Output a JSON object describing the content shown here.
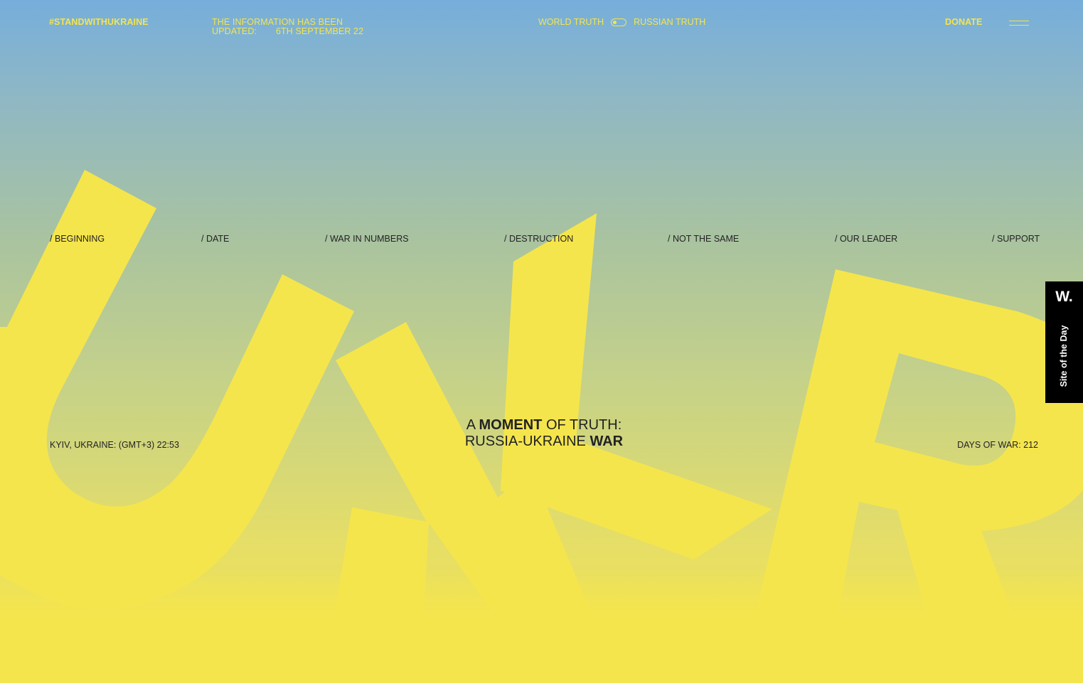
{
  "header": {
    "hashtag": "#STANDWITHUKRAINE",
    "updated_line1": "THE INFORMATION HAS BEEN",
    "updated_label": "UPDATED:",
    "updated_date": "6TH SEPTEMBER 22",
    "truth_left": "WORLD TRUTH",
    "truth_right": "RUSSIAN TRUTH",
    "toggle_state": "world",
    "donate": "DONATE",
    "menu_icon": "hamburger-menu-icon"
  },
  "nav": [
    "/ BEGINNING",
    "/ DATE",
    "/ WAR IN NUMBERS",
    "/ DESTRUCTION",
    "/ NOT THE SAME",
    "/ OUR LEADER",
    "/ SUPPORT"
  ],
  "hero": {
    "background_word": "UKR",
    "location_time": "KYIV, UKRAINE: (GMT+3) 22:53",
    "headline_a": "A ",
    "headline_moment": "MOMENT",
    "headline_of_truth": " OF TRUTH:",
    "headline_russia_ukraine": "RUSSIA-UKRAINE ",
    "headline_war": "WAR",
    "days_of_war": "DAYS OF WAR: 212"
  },
  "award": {
    "logo": "W.",
    "label": "Site of the Day"
  },
  "colors": {
    "yellow": "#f5e54c",
    "blue": "#76aedb",
    "ink": "#222222",
    "badge": "#000000"
  }
}
